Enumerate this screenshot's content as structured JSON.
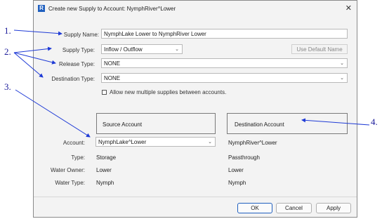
{
  "window": {
    "title": "Create new Supply to Account: NymphRiver^Lower",
    "close_glyph": "✕",
    "app_icon_glyph": "R"
  },
  "form": {
    "supply_name_label": "Supply Name:",
    "supply_name_value": "NymphLake Lower to NymphRiver Lower",
    "supply_type_label": "Supply Type:",
    "supply_type_value": "Inflow / Outflow",
    "use_default_name_label": "Use Default Name",
    "release_type_label": "Release Type:",
    "release_type_value": "NONE",
    "destination_type_label": "Destination Type:",
    "destination_type_value": "NONE",
    "allow_multiple_label": "Allow new multiple supplies between accounts.",
    "allow_multiple_checked": false
  },
  "accounts": {
    "source_header": "Source Account",
    "destination_header": "Destination Account",
    "account_label": "Account:",
    "type_label": "Type:",
    "water_owner_label": "Water Owner:",
    "water_type_label": "Water Type:",
    "source": {
      "account": "NymphLake^Lower",
      "type": "Storage",
      "water_owner": "Lower",
      "water_type": "Nymph"
    },
    "destination": {
      "account": "NymphRiver^Lower",
      "type": "Passthrough",
      "water_owner": "Lower",
      "water_type": "Nymph"
    }
  },
  "buttons": {
    "ok": "OK",
    "cancel": "Cancel",
    "apply": "Apply"
  },
  "annotations": {
    "a1": "1.",
    "a2": "2.",
    "a3": "3.",
    "a4": "4."
  },
  "icons": {
    "caret": "⌄"
  },
  "colors": {
    "annotation_blue": "#1a1a9a",
    "arrow_blue": "#1f3bd6",
    "app_icon": "#1f5fbf"
  }
}
